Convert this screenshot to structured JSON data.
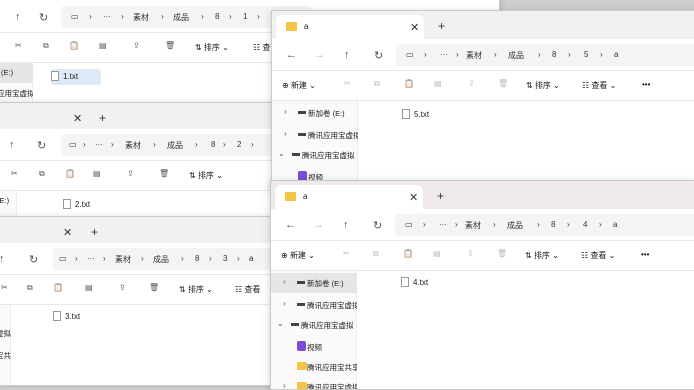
{
  "windows": {
    "w1": {
      "path": [
        "素材",
        "成品",
        "8",
        "1"
      ],
      "file": "1.txt",
      "side": [
        "(E:)",
        "应用宝虚拟"
      ]
    },
    "w2": {
      "path": [
        "素材",
        "成品",
        "8",
        "2"
      ],
      "file": "2.txt",
      "side": [
        "(E:)"
      ],
      "sort": "排序"
    },
    "w3": {
      "path": [
        "素材",
        "成品",
        "8",
        "3",
        "a"
      ],
      "file": "3.txt",
      "side": [
        "虚拟",
        "宝共"
      ],
      "sort": "排序",
      "view": "查看"
    },
    "w4": {
      "tab": "a",
      "path": [
        "素材",
        "成品",
        "8",
        "5",
        "a"
      ],
      "new": "新建",
      "sort": "排序",
      "view": "查看",
      "side": [
        "新加卷 (E:)",
        "腾讯应用宝虚拟",
        "腾讯应用宝虚拟",
        "视频"
      ],
      "file": "5.txt"
    },
    "w5": {
      "tab": "a",
      "path": [
        "素材",
        "成品",
        "8",
        "4",
        "a"
      ],
      "new": "新建",
      "sort": "排序",
      "view": "查看",
      "side": [
        "新加卷 (E:)",
        "腾讯应用宝虚拟",
        "腾讯应用宝虚拟",
        "视频",
        "腾讯应用宝共享",
        "腾讯应用宝虚拟"
      ],
      "file": "4.txt"
    }
  },
  "glyphs": {
    "close": "✕",
    "add": "+",
    "back": "←",
    "forward": "→",
    "up": "↑",
    "refresh": "↻",
    "sep": "›",
    "more_path": "···",
    "more": "•••",
    "pc": "▭"
  }
}
